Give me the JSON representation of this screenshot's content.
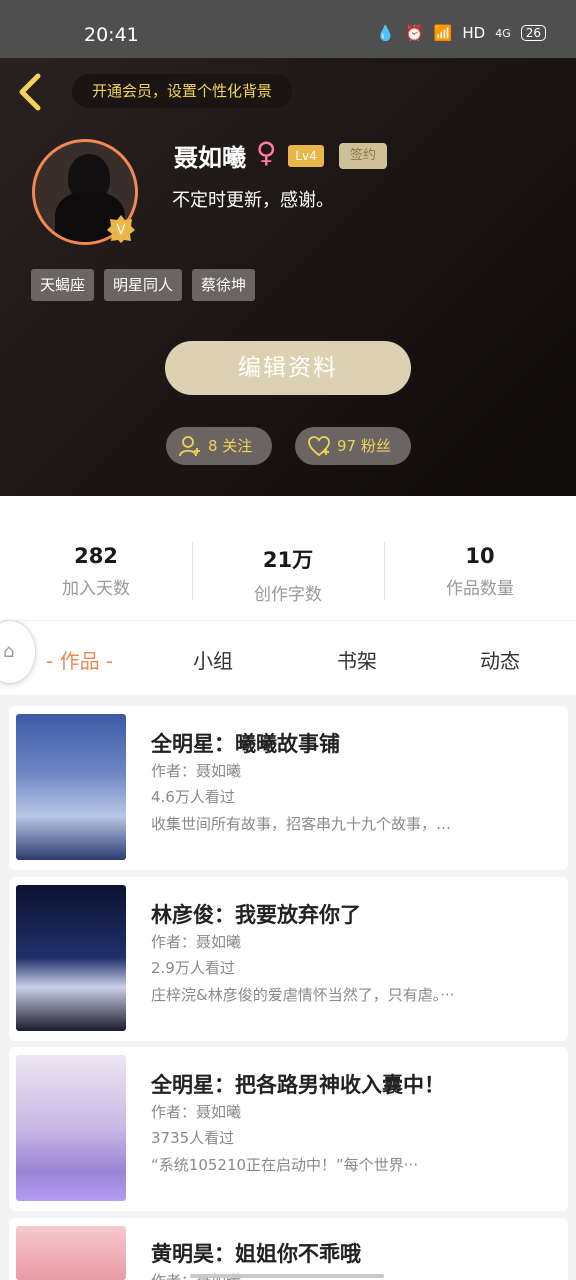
{
  "status_bar": {
    "time": "20:41",
    "network": "HD",
    "cell": "4G",
    "battery": "26"
  },
  "header": {
    "vip_banner": "开通会员，设置个性化背景",
    "username": "聂如曦",
    "gender_symbol": "♀",
    "level": "Lv4",
    "sign_badge": "签约",
    "bio": "不定时更新，感谢。",
    "tags": [
      "天蝎座",
      "明星同人",
      "蔡徐坤"
    ],
    "edit_button": "编辑资料",
    "follow_label": "8 关注",
    "fans_label": "97 粉丝",
    "accent_color": "#f2d35a",
    "avatar_border_color": "#f08a54"
  },
  "stats": [
    {
      "value": "282",
      "label": "加入天数"
    },
    {
      "value": "21万",
      "label": "创作字数"
    },
    {
      "value": "10",
      "label": "作品数量"
    }
  ],
  "tabs": [
    {
      "label": "- 作品 -",
      "active": true
    },
    {
      "label": "小组",
      "active": false
    },
    {
      "label": "书架",
      "active": false
    },
    {
      "label": "动态",
      "active": false
    }
  ],
  "works": [
    {
      "title": "全明星：曦曦故事铺",
      "author": "作者：聂如曦",
      "views": "4.6万人看过",
      "desc": "收集世间所有故事，招客串九十九个故事，…"
    },
    {
      "title": "林彦俊：我要放弃你了",
      "author": "作者：聂如曦",
      "views": "2.9万人看过",
      "desc": "庄梓浣&林彦俊的爱虐情怀当然了，只有虐。···"
    },
    {
      "title": "全明星：把各路男神收入囊中！",
      "author": "作者：聂如曦",
      "views": "3735人看过",
      "desc": "“系统105210正在启动中！”每个世界···"
    },
    {
      "title": "黄明昊：姐姐你不乖哦",
      "author": "作者：聂如曦",
      "views": "",
      "desc": ""
    }
  ]
}
